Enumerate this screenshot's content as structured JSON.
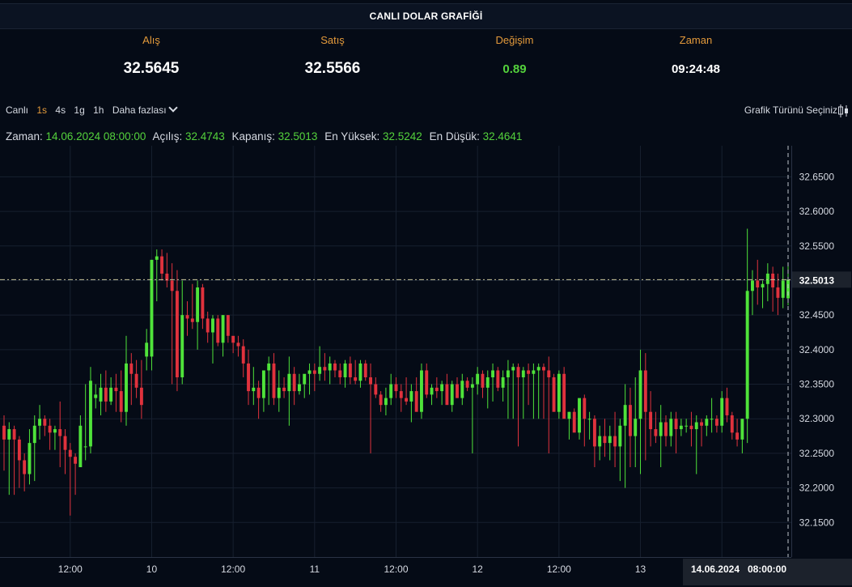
{
  "title": "CANLI DOLAR GRAFİĞİ",
  "stats": [
    {
      "label": "Alış",
      "value": "32.5645"
    },
    {
      "label": "Satış",
      "value": "32.5566"
    },
    {
      "label": "Değişim",
      "value": "0.89"
    },
    {
      "label": "Zaman",
      "value": "09:24:48"
    }
  ],
  "toolbar": {
    "live": "Canlı",
    "intervals": [
      "1s",
      "4s",
      "1g",
      "1h"
    ],
    "active_interval": "1s",
    "more": "Daha fazlası",
    "chart_type": "Grafik Türünü Seçiniz"
  },
  "ohlc": {
    "time_label": "Zaman:",
    "time_value": "14.06.2024 08:00:00",
    "open_label": "Açılış:",
    "open_value": "32.4743",
    "close_label": "Kapanış:",
    "close_value": "32.5013",
    "high_label": "En Yüksek:",
    "high_value": "32.5242",
    "low_label": "En Düşük:",
    "low_value": "32.4641"
  },
  "colors": {
    "up": "#4fe33a",
    "down": "#e0323d",
    "accent": "#e39a3b",
    "crosshair": "#c8c49a"
  },
  "chart_data": {
    "type": "candlestick",
    "y_ticks": [
      "32.6500",
      "32.6000",
      "32.5500",
      "32.5000",
      "32.4500",
      "32.4000",
      "32.3500",
      "32.3000",
      "32.2500",
      "32.2000",
      "32.1500"
    ],
    "ylim": [
      32.1,
      32.695
    ],
    "x_ticks": [
      "12:00",
      "10",
      "12:00",
      "11",
      "12:00",
      "12",
      "12:00",
      "13",
      "12:00"
    ],
    "x_tick_index": [
      13,
      29,
      45,
      61,
      77,
      93,
      109,
      125,
      141
    ],
    "current_price_label": "32.5013",
    "crosshair_date": "14.06.2024",
    "crosshair_time": "08:00:00",
    "grid": true,
    "candles": [
      [
        32.29,
        32.305,
        32.225,
        32.27
      ],
      [
        32.27,
        32.295,
        32.19,
        32.285
      ],
      [
        32.285,
        32.29,
        32.19,
        32.27
      ],
      [
        32.27,
        32.275,
        32.2,
        32.24
      ],
      [
        32.24,
        32.25,
        32.195,
        32.22
      ],
      [
        32.22,
        32.285,
        32.205,
        32.265
      ],
      [
        32.265,
        32.305,
        32.21,
        32.29
      ],
      [
        32.29,
        32.32,
        32.27,
        32.3
      ],
      [
        32.3,
        32.305,
        32.275,
        32.29
      ],
      [
        32.29,
        32.3,
        32.255,
        32.28
      ],
      [
        32.28,
        32.29,
        32.255,
        32.285
      ],
      [
        32.285,
        32.325,
        32.23,
        32.275
      ],
      [
        32.275,
        32.285,
        32.22,
        32.255
      ],
      [
        32.255,
        32.265,
        32.16,
        32.245
      ],
      [
        32.245,
        32.25,
        32.19,
        32.235
      ],
      [
        32.23,
        32.305,
        32.23,
        32.29
      ],
      [
        32.26,
        32.35,
        32.24,
        32.26
      ],
      [
        32.26,
        32.375,
        32.25,
        32.355
      ],
      [
        32.33,
        32.35,
        32.315,
        32.335
      ],
      [
        32.325,
        32.365,
        32.305,
        32.345
      ],
      [
        32.345,
        32.37,
        32.31,
        32.325
      ],
      [
        32.325,
        32.36,
        32.32,
        32.345
      ],
      [
        32.345,
        32.365,
        32.31,
        32.34
      ],
      [
        32.34,
        32.37,
        32.295,
        32.31
      ],
      [
        32.31,
        32.42,
        32.29,
        32.38
      ],
      [
        32.38,
        32.395,
        32.32,
        32.365
      ],
      [
        32.365,
        32.385,
        32.33,
        32.345
      ],
      [
        32.345,
        32.385,
        32.3,
        32.32
      ],
      [
        32.39,
        32.43,
        32.37,
        32.41
      ],
      [
        32.39,
        32.455,
        32.37,
        32.53
      ],
      [
        32.53,
        32.545,
        32.47,
        32.535
      ],
      [
        32.535,
        32.545,
        32.5,
        32.51
      ],
      [
        32.51,
        32.54,
        32.49,
        32.5
      ],
      [
        32.5,
        32.525,
        32.35,
        32.485
      ],
      [
        32.485,
        32.515,
        32.34,
        32.36
      ],
      [
        32.36,
        32.5,
        32.35,
        32.45
      ],
      [
        32.45,
        32.47,
        32.42,
        32.445
      ],
      [
        32.445,
        32.495,
        32.43,
        32.44
      ],
      [
        32.44,
        32.5,
        32.4,
        32.49
      ],
      [
        32.49,
        32.495,
        32.43,
        32.445
      ],
      [
        32.445,
        32.455,
        32.41,
        32.425
      ],
      [
        32.425,
        32.45,
        32.38,
        32.445
      ],
      [
        32.445,
        32.45,
        32.405,
        32.41
      ],
      [
        32.41,
        32.45,
        32.39,
        32.45
      ],
      [
        32.45,
        32.45,
        32.41,
        32.42
      ],
      [
        32.42,
        32.41,
        32.395,
        32.41
      ],
      [
        32.41,
        32.42,
        32.39,
        32.405
      ],
      [
        32.405,
        32.415,
        32.36,
        32.38
      ],
      [
        32.38,
        32.4,
        32.32,
        32.34
      ],
      [
        32.34,
        32.375,
        32.32,
        32.345
      ],
      [
        32.345,
        32.355,
        32.3,
        32.33
      ],
      [
        32.33,
        32.365,
        32.31,
        32.37
      ],
      [
        32.37,
        32.39,
        32.32,
        32.38
      ],
      [
        32.38,
        32.395,
        32.32,
        32.33
      ],
      [
        32.33,
        32.37,
        32.31,
        32.345
      ],
      [
        32.345,
        32.36,
        32.33,
        32.34
      ],
      [
        32.34,
        32.39,
        32.29,
        32.365
      ],
      [
        32.365,
        32.375,
        32.32,
        32.34
      ],
      [
        32.34,
        32.365,
        32.335,
        32.35
      ],
      [
        32.35,
        32.35,
        32.33,
        32.365
      ],
      [
        32.365,
        32.38,
        32.335,
        32.37
      ],
      [
        32.37,
        32.38,
        32.34,
        32.365
      ],
      [
        32.365,
        32.405,
        32.355,
        32.375
      ],
      [
        32.375,
        32.395,
        32.355,
        32.37
      ],
      [
        32.37,
        32.39,
        32.35,
        32.38
      ],
      [
        32.38,
        32.385,
        32.36,
        32.37
      ],
      [
        32.37,
        32.38,
        32.35,
        32.36
      ],
      [
        32.36,
        32.385,
        32.345,
        32.38
      ],
      [
        32.38,
        32.39,
        32.35,
        32.36
      ],
      [
        32.36,
        32.385,
        32.35,
        32.355
      ],
      [
        32.355,
        32.385,
        32.345,
        32.38
      ],
      [
        32.38,
        32.385,
        32.355,
        32.36
      ],
      [
        32.36,
        32.38,
        32.25,
        32.35
      ],
      [
        32.35,
        32.36,
        32.33,
        32.335
      ],
      [
        32.335,
        32.34,
        32.31,
        32.32
      ],
      [
        32.32,
        32.345,
        32.305,
        32.33
      ],
      [
        32.33,
        32.365,
        32.32,
        32.35
      ],
      [
        32.35,
        32.36,
        32.33,
        32.34
      ],
      [
        32.34,
        32.35,
        32.31,
        32.33
      ],
      [
        32.33,
        32.36,
        32.32,
        32.325
      ],
      [
        32.325,
        32.35,
        32.295,
        32.34
      ],
      [
        32.34,
        32.36,
        32.33,
        32.31
      ],
      [
        32.31,
        32.38,
        32.3,
        32.37
      ],
      [
        32.37,
        32.38,
        32.33,
        32.335
      ],
      [
        32.335,
        32.35,
        32.32,
        32.345
      ],
      [
        32.345,
        32.36,
        32.33,
        32.34
      ],
      [
        32.34,
        32.355,
        32.32,
        32.35
      ],
      [
        32.35,
        32.365,
        32.33,
        32.32
      ],
      [
        32.32,
        32.355,
        32.31,
        32.35
      ],
      [
        32.35,
        32.36,
        32.33,
        32.33
      ],
      [
        32.33,
        32.365,
        32.32,
        32.355
      ],
      [
        32.355,
        32.36,
        32.34,
        32.345
      ],
      [
        32.345,
        32.36,
        32.25,
        32.35
      ],
      [
        32.35,
        32.375,
        32.335,
        32.365
      ],
      [
        32.365,
        32.37,
        32.33,
        32.345
      ],
      [
        32.345,
        32.37,
        32.315,
        32.36
      ],
      [
        32.36,
        32.38,
        32.325,
        32.37
      ],
      [
        32.37,
        32.375,
        32.34,
        32.345
      ],
      [
        32.345,
        32.37,
        32.325,
        32.36
      ],
      [
        32.36,
        32.385,
        32.3,
        32.37
      ],
      [
        32.37,
        32.38,
        32.3,
        32.375
      ],
      [
        32.375,
        32.38,
        32.26,
        32.36
      ],
      [
        32.36,
        32.375,
        32.3,
        32.37
      ],
      [
        32.37,
        32.38,
        32.32,
        32.365
      ],
      [
        32.365,
        32.38,
        32.3,
        32.37
      ],
      [
        32.37,
        32.38,
        32.3,
        32.375
      ],
      [
        32.375,
        32.38,
        32.3,
        32.37
      ],
      [
        32.37,
        32.39,
        32.25,
        32.36
      ],
      [
        32.36,
        32.365,
        32.32,
        32.31
      ],
      [
        32.31,
        32.37,
        32.3,
        32.365
      ],
      [
        32.365,
        32.375,
        32.33,
        32.3
      ],
      [
        32.3,
        32.31,
        32.27,
        32.31
      ],
      [
        32.31,
        32.315,
        32.3,
        32.28
      ],
      [
        32.28,
        32.32,
        32.27,
        32.33
      ],
      [
        32.33,
        32.335,
        32.26,
        32.3
      ],
      [
        32.3,
        32.31,
        32.27,
        32.3
      ],
      [
        32.3,
        32.305,
        32.23,
        32.26
      ],
      [
        32.26,
        32.29,
        32.24,
        32.275
      ],
      [
        32.275,
        32.3,
        32.245,
        32.265
      ],
      [
        32.265,
        32.29,
        32.24,
        32.275
      ],
      [
        32.275,
        32.31,
        32.23,
        32.26
      ],
      [
        32.26,
        32.3,
        32.21,
        32.29
      ],
      [
        32.29,
        32.35,
        32.2,
        32.32
      ],
      [
        32.32,
        32.345,
        32.23,
        32.275
      ],
      [
        32.275,
        32.36,
        32.23,
        32.3
      ],
      [
        32.3,
        32.4,
        32.22,
        32.37
      ],
      [
        32.37,
        32.395,
        32.24,
        32.31
      ],
      [
        32.31,
        32.34,
        32.26,
        32.285
      ],
      [
        32.285,
        32.31,
        32.265,
        32.275
      ],
      [
        32.275,
        32.32,
        32.23,
        32.295
      ],
      [
        32.295,
        32.305,
        32.26,
        32.275
      ],
      [
        32.275,
        32.31,
        32.26,
        32.3
      ],
      [
        32.3,
        32.31,
        32.25,
        32.285
      ],
      [
        32.285,
        32.3,
        32.275,
        32.29
      ],
      [
        32.29,
        32.3,
        32.28,
        32.29
      ],
      [
        32.29,
        32.31,
        32.26,
        32.285
      ],
      [
        32.285,
        32.305,
        32.22,
        32.295
      ],
      [
        32.295,
        32.3,
        32.26,
        32.29
      ],
      [
        32.29,
        32.305,
        32.275,
        32.3
      ],
      [
        32.3,
        32.33,
        32.28,
        32.3
      ],
      [
        32.3,
        32.305,
        32.28,
        32.29
      ],
      [
        32.29,
        32.34,
        32.28,
        32.33
      ],
      [
        32.33,
        32.345,
        32.295,
        32.305
      ],
      [
        32.305,
        32.31,
        32.27,
        32.28
      ],
      [
        32.28,
        32.3,
        32.26,
        32.27
      ],
      [
        32.27,
        32.3,
        32.25,
        32.3
      ],
      [
        32.3,
        32.575,
        32.265,
        32.485
      ],
      [
        32.485,
        32.515,
        32.45,
        32.5
      ],
      [
        32.5,
        32.53,
        32.465,
        32.49
      ],
      [
        32.49,
        32.5,
        32.46,
        32.495
      ],
      [
        32.495,
        32.525,
        32.47,
        32.51
      ],
      [
        32.51,
        32.52,
        32.455,
        32.49
      ],
      [
        32.49,
        32.51,
        32.45,
        32.475
      ],
      [
        32.475,
        32.52,
        32.46,
        32.5
      ],
      [
        32.4743,
        32.5242,
        32.4641,
        32.5013
      ]
    ]
  }
}
